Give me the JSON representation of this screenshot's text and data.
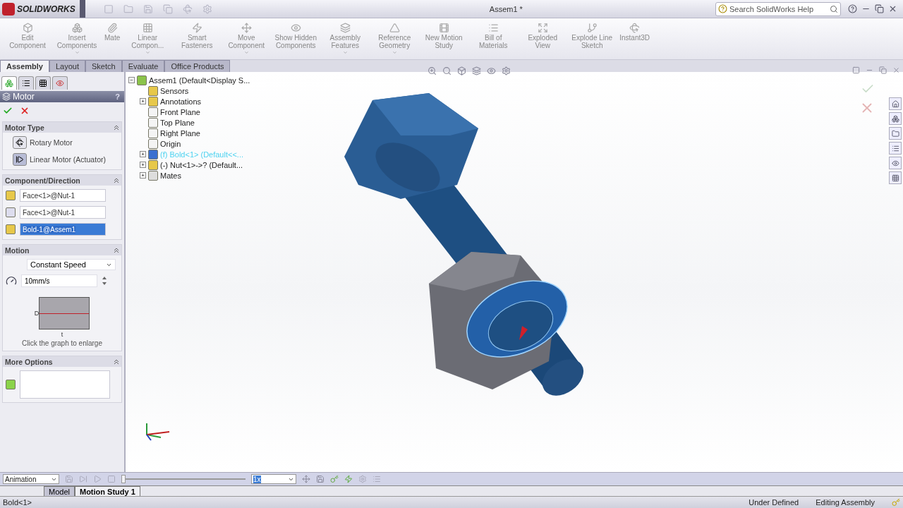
{
  "title_bar": {
    "app_name": "SOLIDWORKS",
    "document_title": "Assem1 *",
    "search": {
      "placeholder": "Search SolidWorks Help"
    }
  },
  "ribbon": [
    {
      "label": "Edit Component",
      "has_menu": false
    },
    {
      "label": "Insert Components",
      "has_menu": true
    },
    {
      "label": "Mate",
      "has_menu": false
    },
    {
      "label": "Linear Compon...",
      "has_menu": true
    },
    {
      "label": "Smart Fasteners",
      "has_menu": false
    },
    {
      "label": "Move Component",
      "has_menu": true
    },
    {
      "label": "Show Hidden Components",
      "has_menu": false
    },
    {
      "label": "Assembly Features",
      "has_menu": true
    },
    {
      "label": "Reference Geometry",
      "has_menu": true
    },
    {
      "label": "New Motion Study",
      "has_menu": false
    },
    {
      "label": "Bill of Materials",
      "has_menu": false
    },
    {
      "label": "Exploded View",
      "has_menu": false
    },
    {
      "label": "Explode Line Sketch",
      "has_menu": false
    },
    {
      "label": "Instant3D",
      "has_menu": false
    }
  ],
  "tabs": [
    {
      "label": "Assembly",
      "selected": true
    },
    {
      "label": "Layout",
      "selected": false
    },
    {
      "label": "Sketch",
      "selected": false
    },
    {
      "label": "Evaluate",
      "selected": false
    },
    {
      "label": "Office Products",
      "selected": false
    }
  ],
  "property_manager": {
    "title": "Motor",
    "help": "?",
    "sections": [
      {
        "kind": "motor_type",
        "title": "Motor Type",
        "options": [
          {
            "label": "Rotary Motor",
            "selected": false
          },
          {
            "label": "Linear Motor (Actuator)",
            "selected": true
          }
        ]
      },
      {
        "kind": "direction",
        "title": "Component/Direction",
        "fields": [
          {
            "value": "Face<1>@Nut-1",
            "selected": false
          },
          {
            "value": "Face<1>@Nut-1",
            "selected": false
          },
          {
            "value": "Bold-1@Assem1",
            "selected": true
          }
        ]
      },
      {
        "kind": "motion",
        "title": "Motion",
        "function": "Constant Speed",
        "speed": "10mm/s",
        "graph_y": "D",
        "graph_x": "t",
        "hint": "Click the graph to enlarge"
      },
      {
        "kind": "more_options",
        "title": "More Options"
      }
    ]
  },
  "feature_tree": {
    "label": "Assem1  (Default<Display S...",
    "expander": "−",
    "highlighted": false,
    "children": [
      {
        "label": "Sensors",
        "highlighted": false
      },
      {
        "label": "Annotations",
        "expander": "+",
        "highlighted": false
      },
      {
        "label": "Front Plane",
        "highlighted": false
      },
      {
        "label": "Top Plane",
        "highlighted": false
      },
      {
        "label": "Right Plane",
        "highlighted": false
      },
      {
        "label": "Origin",
        "highlighted": false
      },
      {
        "label": "(f) Bold<1> (Default<<...",
        "expander": "+",
        "highlighted": true
      },
      {
        "label": "(-) Nut<1>->? (Default...",
        "expander": "+",
        "highlighted": false
      },
      {
        "label": "Mates",
        "expander": "+",
        "highlighted": false
      }
    ]
  },
  "motion_manager": {
    "study_type": "Animation",
    "playback_speed": "1x",
    "timeline": {
      "level": 0
    },
    "study_tabs": [
      {
        "label": "Model",
        "selected": false
      },
      {
        "label": "Motion Study 1",
        "selected": true
      }
    ]
  },
  "status_bar": {
    "selection": "Bold<1>",
    "items": [
      "Under Defined",
      "Editing Assembly"
    ]
  }
}
